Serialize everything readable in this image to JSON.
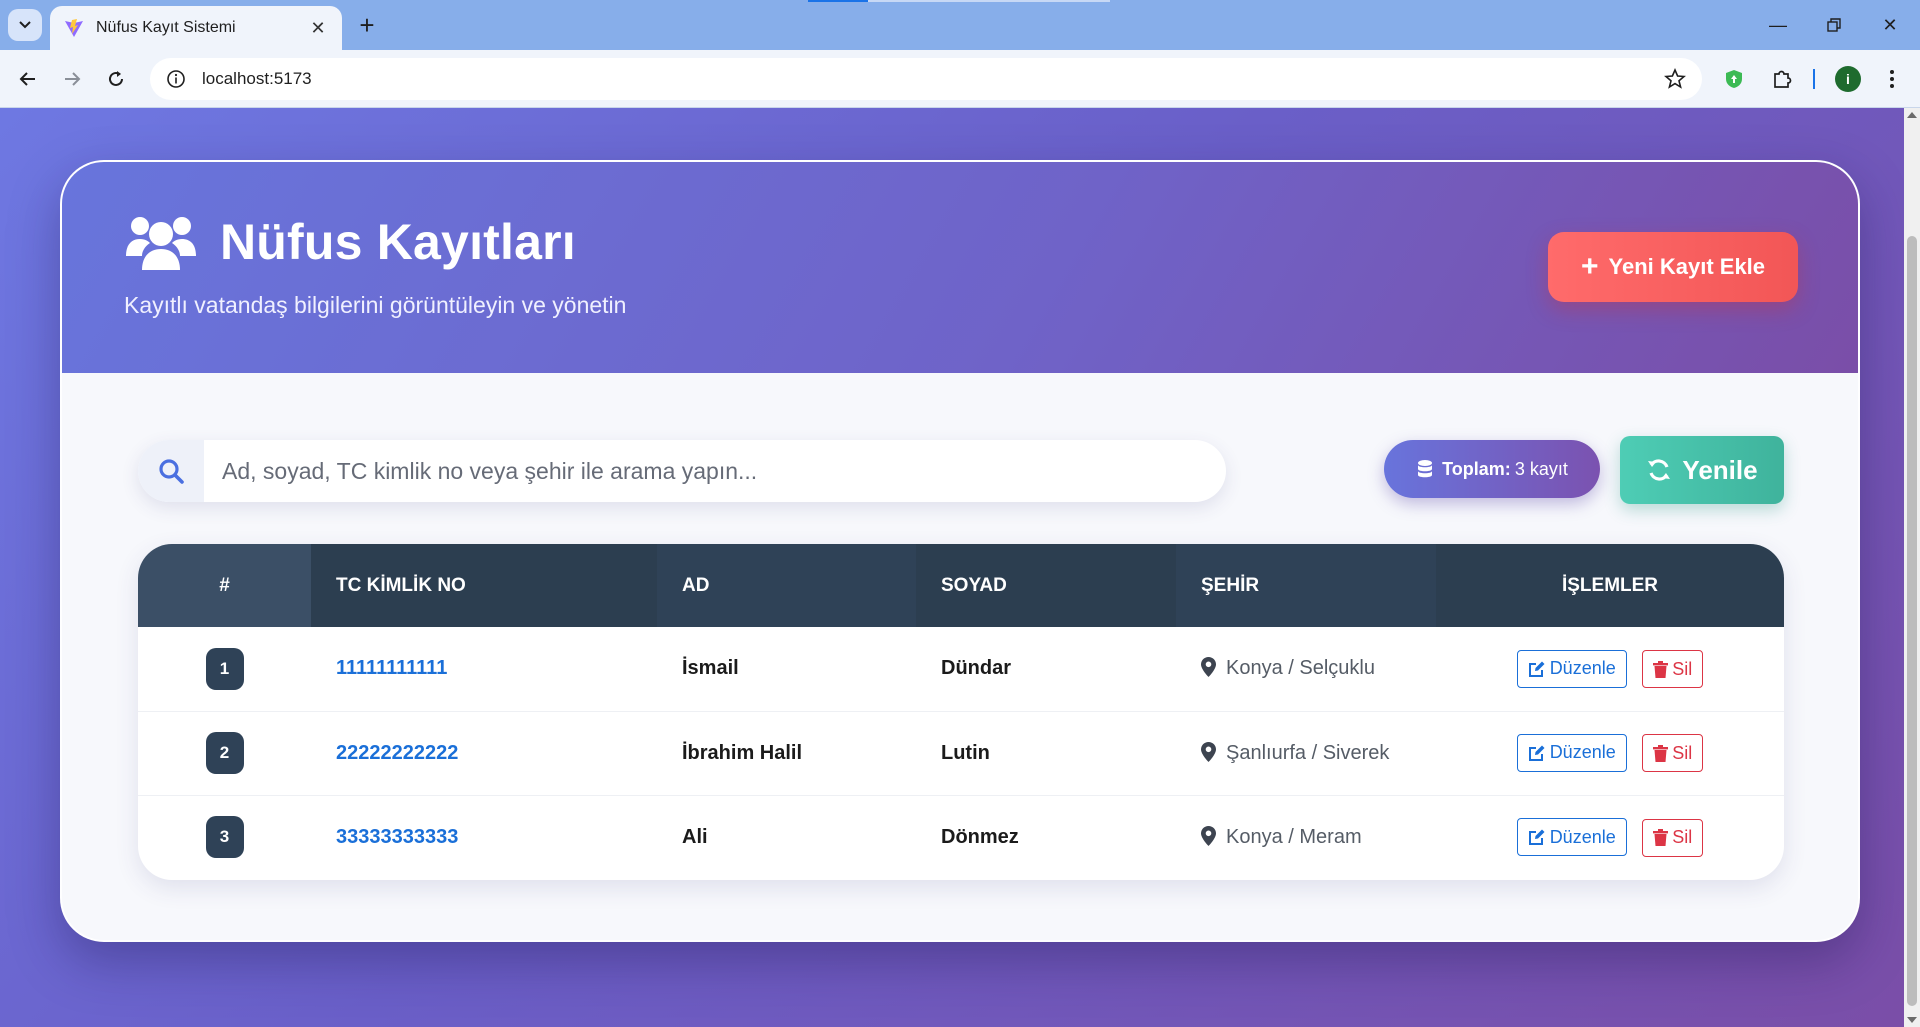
{
  "browser": {
    "tab_title": "Nüfus Kayıt Sistemi",
    "url": "localhost:5173"
  },
  "header": {
    "title": "Nüfus Kayıtları",
    "subtitle": "Kayıtlı vatandaş bilgilerini görüntüleyin ve yönetin",
    "add_button_label": "Yeni Kayıt Ekle"
  },
  "toolbar": {
    "search_placeholder": "Ad, soyad, TC kimlik no veya şehir ile arama yapın...",
    "search_value": "",
    "total_label": "Toplam:",
    "total_value": "3 kayıt",
    "refresh_label": "Yenile"
  },
  "table": {
    "columns": [
      "#",
      "TC KİMLİK NO",
      "AD",
      "SOYAD",
      "ŞEHİR",
      "İŞLEMLER"
    ],
    "rows": [
      {
        "index": "1",
        "tc": "11111111111",
        "ad": "İsmail",
        "soyad": "Dündar",
        "sehir": "Konya / Selçuklu"
      },
      {
        "index": "2",
        "tc": "22222222222",
        "ad": "İbrahim Halil",
        "soyad": "Lutin",
        "sehir": "Şanlıurfa / Siverek"
      },
      {
        "index": "3",
        "tc": "33333333333",
        "ad": "Ali",
        "soyad": "Dönmez",
        "sehir": "Konya / Meram"
      }
    ],
    "edit_label": "Düzenle",
    "delete_label": "Sil"
  },
  "colors": {
    "primary": "#6874dc",
    "secondary": "#7a4ea8",
    "danger": "#ff6b6b",
    "success": "#4ecdb5",
    "table_header": "#2c3e50",
    "link": "#1a6fd8"
  },
  "icons": {
    "header": "users-icon",
    "search": "search-icon",
    "total": "database-icon",
    "refresh": "refresh-icon",
    "city": "map-pin-icon",
    "edit": "edit-icon",
    "delete": "trash-icon"
  }
}
